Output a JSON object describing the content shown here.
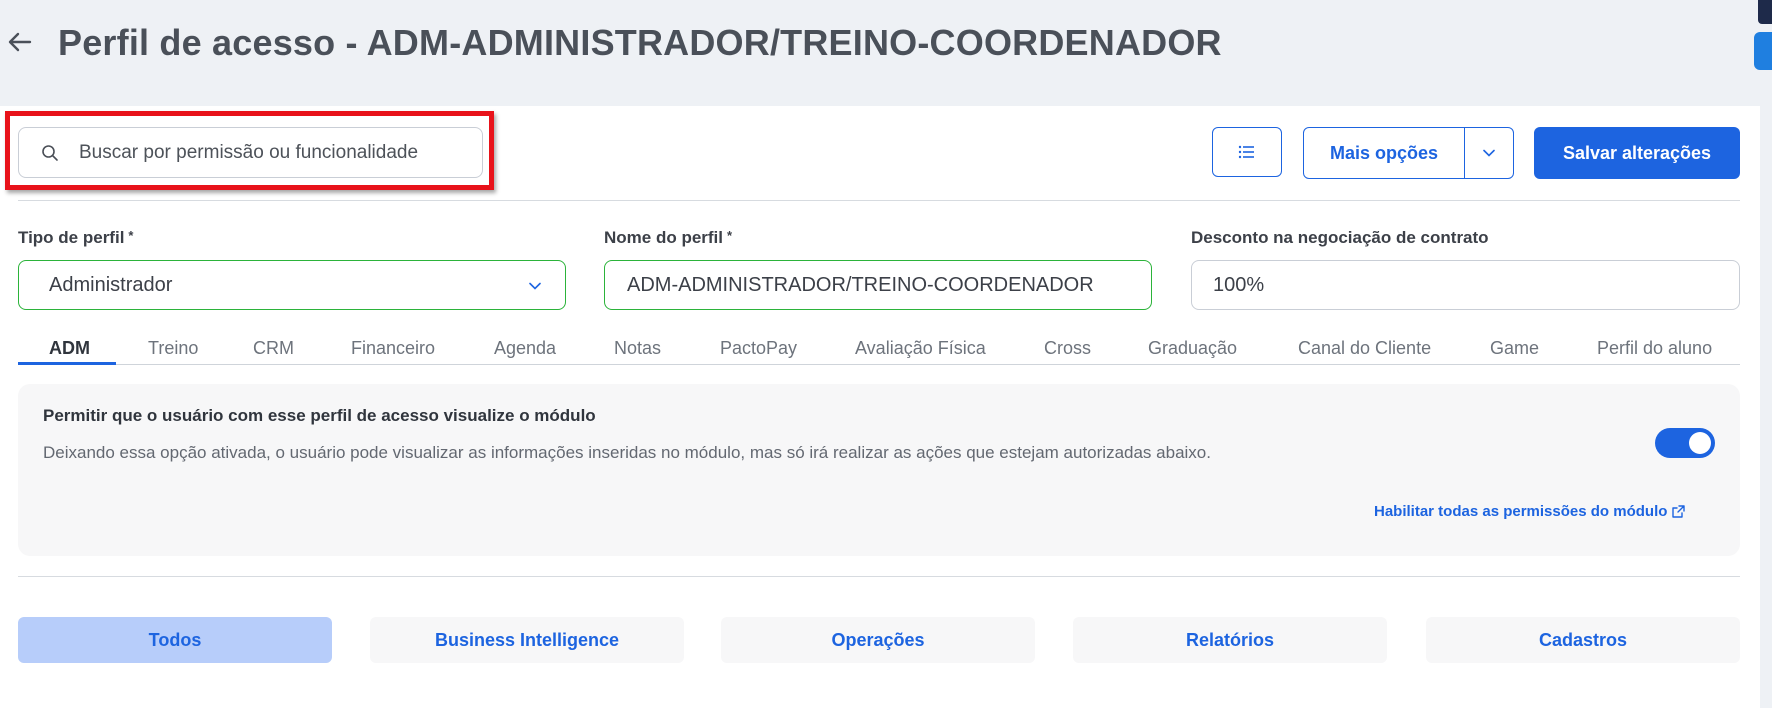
{
  "header": {
    "title": "Perfil de acesso - ADM-ADMINISTRADOR/TREINO-COORDENADOR"
  },
  "search": {
    "placeholder": "Buscar por permissão ou funcionalidade"
  },
  "toolbar": {
    "more_options_label": "Mais opções",
    "save_label": "Salvar alterações"
  },
  "form": {
    "profile_type": {
      "label": "Tipo de perfil",
      "required_mark": "*",
      "value": "Administrador"
    },
    "profile_name": {
      "label": "Nome do perfil",
      "required_mark": "*",
      "value": "ADM-ADMINISTRADOR/TREINO-COORDENADOR"
    },
    "discount": {
      "label": "Desconto na negociação de contrato",
      "value": "100%"
    }
  },
  "module_tabs": [
    {
      "label": "ADM",
      "active": true
    },
    {
      "label": "Treino"
    },
    {
      "label": "CRM"
    },
    {
      "label": "Financeiro"
    },
    {
      "label": "Agenda"
    },
    {
      "label": "Notas"
    },
    {
      "label": "PactoPay"
    },
    {
      "label": "Avaliação Física"
    },
    {
      "label": "Cross"
    },
    {
      "label": "Graduação"
    },
    {
      "label": "Canal do Cliente"
    },
    {
      "label": "Game"
    },
    {
      "label": "Perfil do aluno"
    }
  ],
  "permission": {
    "title": "Permitir que o usuário com esse perfil de acesso visualize o módulo",
    "description": "Deixando essa opção ativada, o usuário pode visualizar as informações inseridas no módulo, mas só irá realizar as ações que estejam autorizadas abaixo.",
    "toggle_on": true,
    "enable_all_link": "Habilitar todas as permissões do módulo"
  },
  "categories": [
    {
      "label": "Todos",
      "active": true
    },
    {
      "label": "Business Intelligence"
    },
    {
      "label": "Operações"
    },
    {
      "label": "Relatórios"
    },
    {
      "label": "Cadastros"
    }
  ],
  "colors": {
    "accent": "#1d64e0",
    "highlight": "#e8121a",
    "valid_border": "#2bb33a",
    "active_category": "#b7cdfa"
  }
}
